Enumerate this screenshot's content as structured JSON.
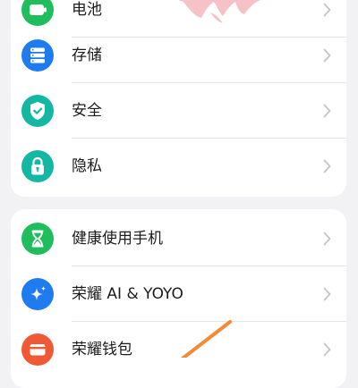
{
  "colors": {
    "page_background": "#f2f2f4",
    "card_background": "#ffffff",
    "green": "#1fbd5b",
    "blue": "#1f7cf0",
    "teal": "#14b7a3",
    "chevron": "#c4c4c8",
    "annotation_orange": "#f58a34",
    "annotation_pink": "#f2aeb5"
  },
  "group1": {
    "items": [
      {
        "label": "电池",
        "icon": "battery-icon"
      },
      {
        "label": "存储",
        "icon": "storage-icon"
      },
      {
        "label": "安全",
        "icon": "security-shield-icon"
      },
      {
        "label": "隐私",
        "icon": "privacy-lock-icon"
      }
    ]
  },
  "group2": {
    "items": [
      {
        "label": "健康使用手机",
        "icon": "hourglass-icon"
      },
      {
        "label": "荣耀 AI & YOYO",
        "icon": "sparkle-icon"
      },
      {
        "label": "荣耀钱包",
        "icon": "wallet-icon"
      }
    ]
  }
}
